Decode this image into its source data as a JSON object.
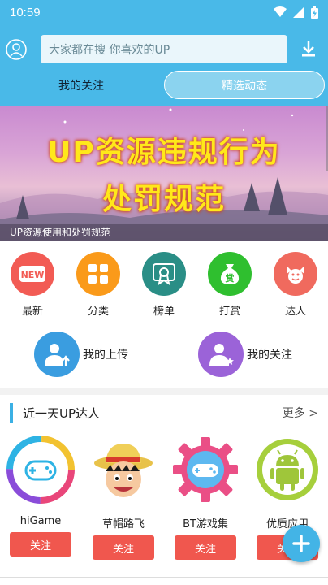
{
  "status": {
    "time": "10:59"
  },
  "search": {
    "placeholder": "大家都在搜  你喜欢的UP"
  },
  "tabs": [
    {
      "label": "我的关注"
    },
    {
      "label": "精选动态"
    }
  ],
  "banner": {
    "line1": "UP资源违规行为",
    "line2": "处罚规范",
    "caption": "UP资源使用和处罚规范"
  },
  "quick_nav": [
    {
      "label": "最新",
      "icon": "new-badge-icon",
      "color": "#f25b54"
    },
    {
      "label": "分类",
      "icon": "grid-icon",
      "color": "#fa9a1a"
    },
    {
      "label": "榜单",
      "icon": "certificate-icon",
      "color": "#2a8e86"
    },
    {
      "label": "打赏",
      "icon": "money-bag-icon",
      "color": "#2fbf2f"
    },
    {
      "label": "达人",
      "icon": "expert-icon",
      "color": "#f06a5e"
    }
  ],
  "big_buttons": [
    {
      "label": "我的上传",
      "icon": "upload-user-icon",
      "color": "#3a9de0"
    },
    {
      "label": "我的关注",
      "icon": "follow-user-icon",
      "color": "#9b63d8"
    }
  ],
  "section": {
    "title": "近一天UP达人",
    "more": "更多 >"
  },
  "uploaders": [
    {
      "name": "hiGame",
      "follow": "关注"
    },
    {
      "name": "草帽路飞",
      "follow": "关注"
    },
    {
      "name": "BT游戏集",
      "follow": "关注"
    },
    {
      "name": "优质应用",
      "follow": "关注"
    }
  ],
  "colors": {
    "primary": "#49b9e8",
    "follow": "#f0574e",
    "banner_text": "#ffe81a"
  }
}
